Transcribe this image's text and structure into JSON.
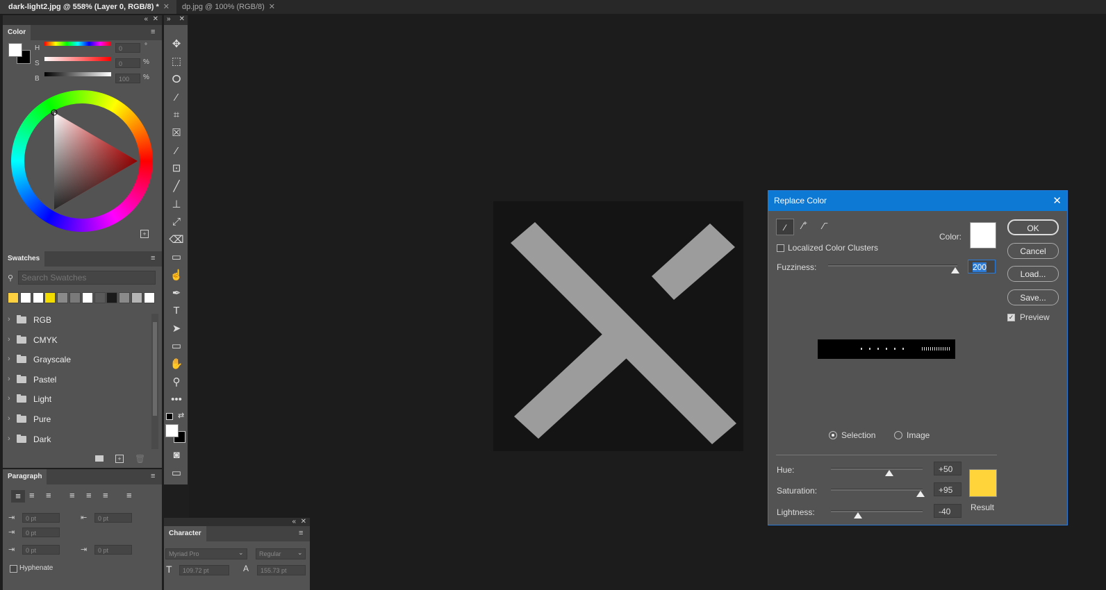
{
  "tabs": [
    {
      "label": "dark-light2.jpg @ 558% (Layer 0, RGB/8) *",
      "active": true
    },
    {
      "label": "dp.jpg @ 100% (RGB/8)",
      "active": false
    }
  ],
  "color_panel": {
    "title": "Color",
    "rows": [
      {
        "letter": "H",
        "value": "0",
        "unit": "°"
      },
      {
        "letter": "S",
        "value": "0",
        "unit": "%"
      },
      {
        "letter": "B",
        "value": "100",
        "unit": "%"
      }
    ]
  },
  "swatches_panel": {
    "title": "Swatches",
    "search_placeholder": "Search Swatches",
    "swatch_colors": [
      "#ffd040",
      "#ffffff",
      "#ffffff",
      "#f2dc00",
      "#8a8a8a",
      "#7a7a7a",
      "#ffffff",
      "#5a5a5a",
      "#1a1a1a",
      "#8a8a8a",
      "#b5b5b5",
      "#ffffff"
    ],
    "groups": [
      "RGB",
      "CMYK",
      "Grayscale",
      "Pastel",
      "Light",
      "Pure",
      "Dark"
    ]
  },
  "paragraph_panel": {
    "title": "Paragraph",
    "fields": [
      "0 pt",
      "0 pt",
      "0 pt",
      "0 pt",
      "0 pt"
    ],
    "hyphenate": "Hyphenate"
  },
  "character_panel": {
    "title": "Character",
    "font_family": "Myriad Pro",
    "font_style": "Regular",
    "size": "109.72 pt",
    "leading": "155.73 pt"
  },
  "dialog": {
    "title": "Replace Color",
    "localized_clusters": "Localized Color Clusters",
    "color_label": "Color:",
    "fuzziness_label": "Fuzziness:",
    "fuzziness_value": "200",
    "fuzziness_fraction": 1.0,
    "selection_label": "Selection",
    "image_label": "Image",
    "buttons": {
      "ok": "OK",
      "cancel": "Cancel",
      "load": "Load...",
      "save": "Save..."
    },
    "preview_label": "Preview",
    "hue_label": "Hue:",
    "hue_value": "+50",
    "saturation_label": "Saturation:",
    "saturation_value": "+95",
    "lightness_label": "Lightness:",
    "lightness_value": "-40",
    "result_label": "Result",
    "result_color": "#ffd43a",
    "color_swatch": "#ffffff"
  }
}
